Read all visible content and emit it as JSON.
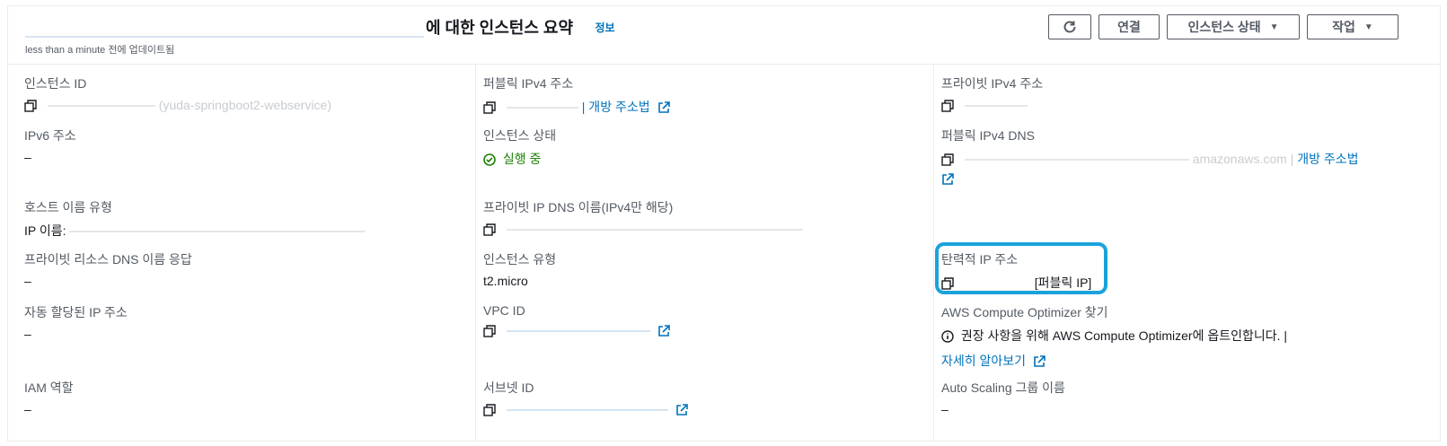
{
  "header": {
    "title": "에 대한 인스턴스 요약",
    "info_link": "정보",
    "subtitle": "less than a minute 전에 업데이트됨",
    "buttons": {
      "connect": "연결",
      "instance_state": "인스턴스 상태",
      "actions": "작업"
    }
  },
  "details": {
    "instance_id": {
      "label": "인스턴스 ID",
      "value": "(yuda-springboot2-webservice)"
    },
    "ipv6": {
      "label": "IPv6 주소",
      "value": "–"
    },
    "hostname_type": {
      "label": "호스트 이름 유형",
      "value": "IP 이름: "
    },
    "private_dns_answer": {
      "label": "프라이빗 리소스 DNS 이름 응답",
      "value": "–"
    },
    "auto_ip": {
      "label": "자동 할당된 IP 주소",
      "value": "–"
    },
    "iam_role": {
      "label": "IAM 역할",
      "value": "–"
    },
    "public_ipv4": {
      "label": "퍼블릭 IPv4 주소",
      "link": "| 개방 주소법"
    },
    "instance_state": {
      "label": "인스턴스 상태",
      "value": "실행 중"
    },
    "private_ip_dns": {
      "label": "프라이빗 IP DNS 이름(IPv4만 해당)"
    },
    "instance_type": {
      "label": "인스턴스 유형",
      "value": "t2.micro"
    },
    "vpc_id": {
      "label": "VPC ID"
    },
    "subnet_id": {
      "label": "서브넷 ID"
    },
    "private_ipv4": {
      "label": "프라이빗 IPv4 주소"
    },
    "public_dns": {
      "label": "퍼블릭 IPv4 DNS",
      "value_tail": "amazonaws.com |",
      "link": "개방 주소법"
    },
    "elastic_ip": {
      "label": "탄력적 IP 주소",
      "value": "[퍼블릭 IP]"
    },
    "optimizer": {
      "label": "AWS Compute Optimizer 찾기",
      "text": "권장 사항을 위해 AWS Compute Optimizer에 옵트인합니다. |",
      "link": "자세히 알아보기"
    },
    "asg_name": {
      "label": "Auto Scaling 그룹 이름",
      "value": "–"
    }
  },
  "colors": {
    "link": "#0073bb",
    "success": "#1d8102",
    "highlight": "#1aa3db"
  }
}
